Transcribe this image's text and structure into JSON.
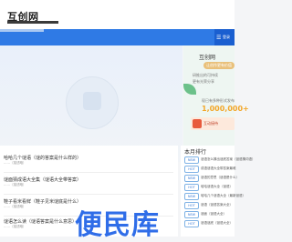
{
  "header": {
    "site_title": "互创网"
  },
  "nav": {
    "login_icon": "☰",
    "login_label": "登录"
  },
  "sidebar": {
    "title": "互创网",
    "badge": "让创作更有价值",
    "line1": "研推出的可持续",
    "line2": "更有光荣分享",
    "count_label": "现已有多种形式发布",
    "count_value": "1,000,000+",
    "cta_label": "互动接待"
  },
  "list": {
    "header": "",
    "items": [
      {
        "title": "哈哈几个谜语（谜的答案是什么样的）",
        "desc": "……（描述略）"
      },
      {
        "title": "谜面猜成语大全集（谜语大全带答案）",
        "desc": "……（描述略）"
      },
      {
        "title": "鞋子看米看鲜（鞋子见米谜底是什么）",
        "desc": "……（描述略）"
      },
      {
        "title": "谜语怎么读（谜语答案是什么意思）",
        "desc": "……（描述略）"
      }
    ]
  },
  "rank": {
    "title": "本月排行",
    "items": [
      {
        "tag": "NEW",
        "text": "谜语怎么猜出谜底答案（谜语猜词语）"
      },
      {
        "tag": "HOT",
        "text": "成语谜语大全带答案最难"
      },
      {
        "tag": "NEW",
        "text": "谜语的意思（谜语是什么）"
      },
      {
        "tag": "HOT",
        "text": "哈哈谜语大全（谜语）"
      },
      {
        "tag": "NEW",
        "text": "哈哈几个谜语大全（最新谜语）"
      },
      {
        "tag": "HOT",
        "text": "谜语（谜语答案大全）"
      },
      {
        "tag": "NEW",
        "text": "谜面（谜语大全）"
      },
      {
        "tag": "HOT",
        "text": "谜语谜底（谜语大全）"
      }
    ]
  },
  "watermark": {
    "text": "便民库"
  }
}
